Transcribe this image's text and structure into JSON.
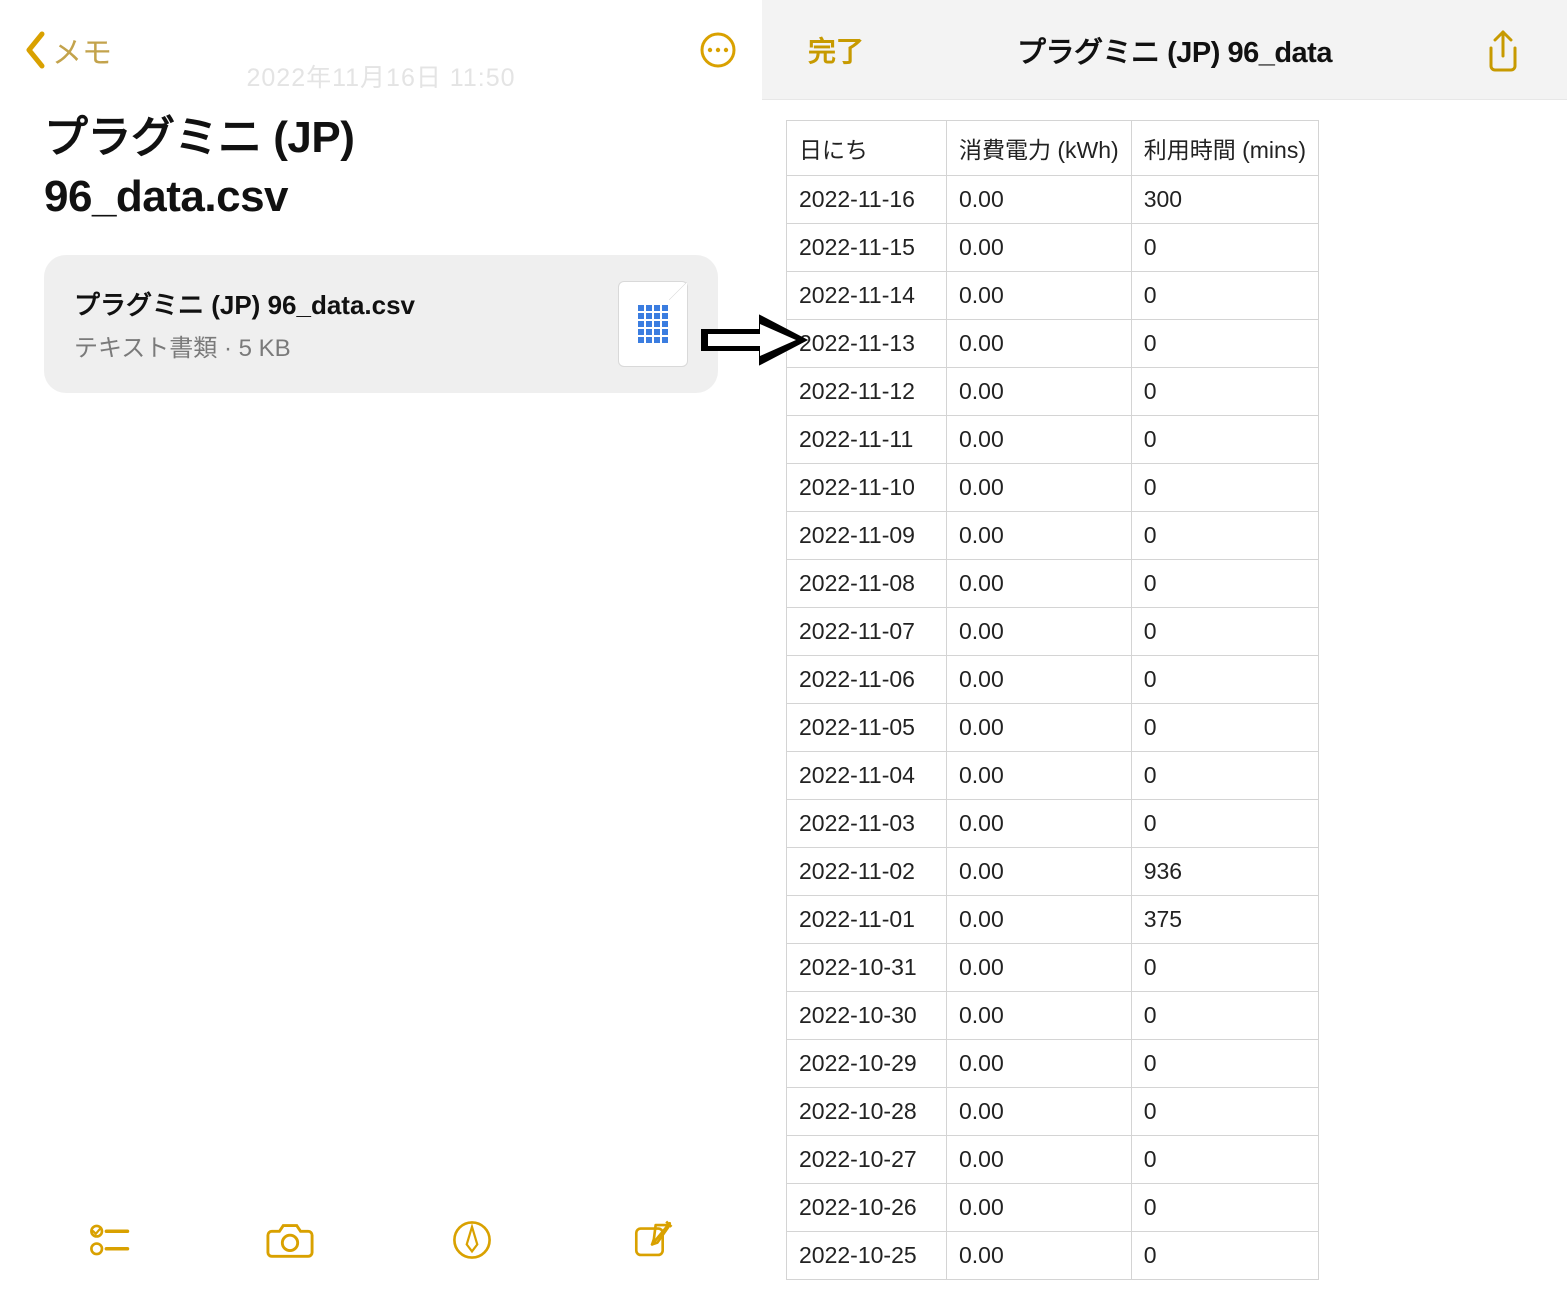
{
  "notes": {
    "back_label": "メモ",
    "faded_timestamp": "2022年11月16日 11:50",
    "title_line1": "プラグミニ (JP)",
    "title_line2": "96_data.csv",
    "attachment": {
      "filename": "プラグミニ (JP) 96_data.csv",
      "meta": "テキスト書類 · 5 KB"
    }
  },
  "viewer": {
    "done_label": "完了",
    "title": "プラグミニ (JP) 96_data"
  },
  "csv": {
    "headers": [
      "日にち",
      "消費電力 (kWh)",
      "利用時間 (mins)"
    ],
    "rows": [
      [
        "2022-11-16",
        "0.00",
        "300"
      ],
      [
        "2022-11-15",
        "0.00",
        "0"
      ],
      [
        "2022-11-14",
        "0.00",
        "0"
      ],
      [
        "2022-11-13",
        "0.00",
        "0"
      ],
      [
        "2022-11-12",
        "0.00",
        "0"
      ],
      [
        "2022-11-11",
        "0.00",
        "0"
      ],
      [
        "2022-11-10",
        "0.00",
        "0"
      ],
      [
        "2022-11-09",
        "0.00",
        "0"
      ],
      [
        "2022-11-08",
        "0.00",
        "0"
      ],
      [
        "2022-11-07",
        "0.00",
        "0"
      ],
      [
        "2022-11-06",
        "0.00",
        "0"
      ],
      [
        "2022-11-05",
        "0.00",
        "0"
      ],
      [
        "2022-11-04",
        "0.00",
        "0"
      ],
      [
        "2022-11-03",
        "0.00",
        "0"
      ],
      [
        "2022-11-02",
        "0.00",
        "936"
      ],
      [
        "2022-11-01",
        "0.00",
        "375"
      ],
      [
        "2022-10-31",
        "0.00",
        "0"
      ],
      [
        "2022-10-30",
        "0.00",
        "0"
      ],
      [
        "2022-10-29",
        "0.00",
        "0"
      ],
      [
        "2022-10-28",
        "0.00",
        "0"
      ],
      [
        "2022-10-27",
        "0.00",
        "0"
      ],
      [
        "2022-10-26",
        "0.00",
        "0"
      ],
      [
        "2022-10-25",
        "0.00",
        "0"
      ]
    ]
  }
}
